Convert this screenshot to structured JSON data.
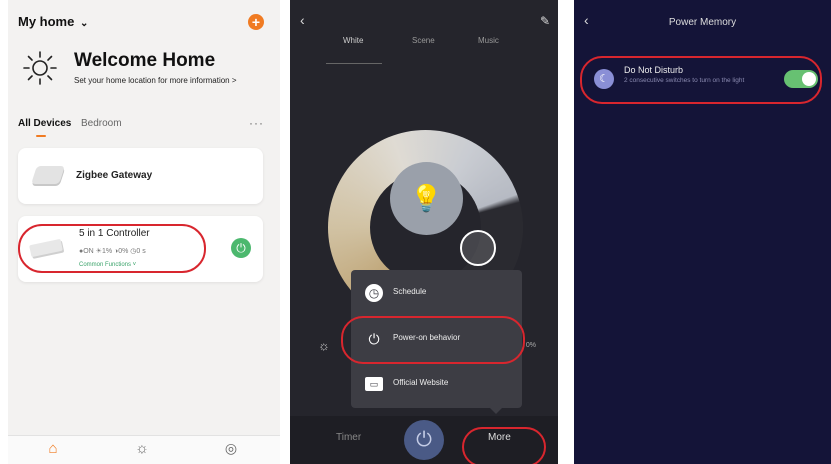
{
  "panel1": {
    "home_title": "My home",
    "welcome_title": "Welcome Home",
    "welcome_subtitle": "Set your home location for more information >",
    "tabs": [
      "All Devices",
      "Bedroom"
    ],
    "more_label": "···",
    "devices": [
      {
        "name": "Zigbee Gateway"
      },
      {
        "name": "5 in 1 Controller",
        "status": "●ON ☀1% ◑0% ◷0 s",
        "common": "Common Functions ˅"
      }
    ],
    "nav": [
      "Home",
      "Scene",
      "Me"
    ]
  },
  "panel2": {
    "tabs": [
      "White",
      "Scene",
      "Music"
    ],
    "brightness_value": "0%",
    "menu": [
      "Schedule",
      "Power-on behavior",
      "Official Website"
    ],
    "bottom": {
      "timer": "Timer",
      "more": "More"
    }
  },
  "panel3": {
    "title": "Power Memory",
    "option_title": "Do Not Disturb",
    "option_subtitle": "2 consecutive switches to turn on the light",
    "toggle_on": true
  },
  "colors": {
    "accent": "#f07b22",
    "green": "#4cb86e",
    "highlight": "#d8262e"
  }
}
